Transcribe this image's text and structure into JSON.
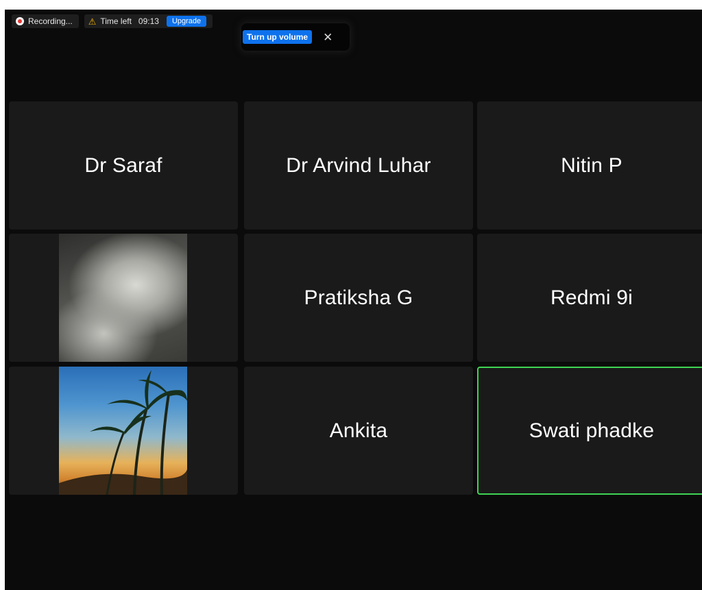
{
  "status_bar": {
    "recording_label": "Recording...",
    "time_label": "Time left",
    "time_value": "09:13",
    "upgrade_label": "Upgrade",
    "colors": {
      "recording": "#e53935",
      "warning": "#f5b400",
      "accent": "#0e72ed"
    }
  },
  "toast": {
    "button_label": "Turn up volume",
    "close_glyph": "✕"
  },
  "participants": [
    {
      "name": "Dr Saraf"
    },
    {
      "name": "Dr Arvind Luhar"
    },
    {
      "name": "Nitin P"
    },
    {
      "name": "",
      "video": "camera-feed-noise"
    },
    {
      "name": "Pratiksha G"
    },
    {
      "name": "Redmi 9i"
    },
    {
      "name": "",
      "video": "camera-feed-beach"
    },
    {
      "name": "Ankita"
    },
    {
      "name": "Swati phadke",
      "active_speaker": true
    }
  ],
  "colors": {
    "active_speaker_border": "#3fd454",
    "tile_bg": "#1a1a1a",
    "window_bg": "#0b0b0b"
  }
}
